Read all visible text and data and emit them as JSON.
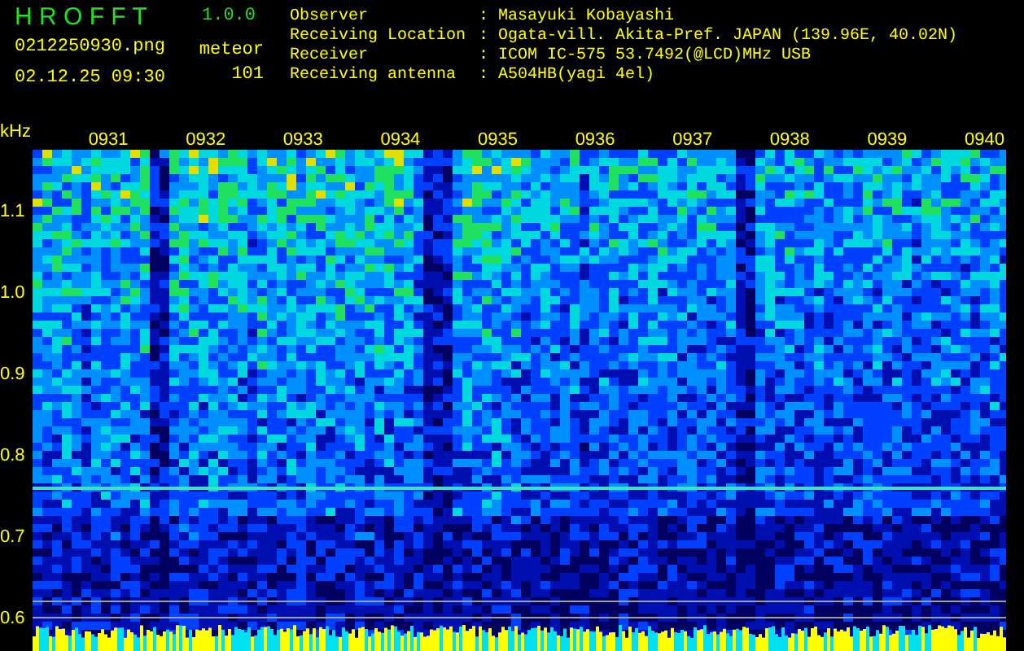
{
  "header": {
    "app_name": "H R O F F T",
    "version": "1.0.0",
    "filename": "0212250930.png",
    "datetime": "02.12.25 09:30",
    "meteor_label": "meteor",
    "meteor_count": "101"
  },
  "info": [
    {
      "label": "Observer",
      "separator": ":",
      "value": "Masayuki Kobayashi"
    },
    {
      "label": "Receiving Location",
      "separator": ":",
      "value": "Ogata-vill. Akita-Pref. JAPAN (139.96E, 40.02N)"
    },
    {
      "label": "Receiver",
      "separator": ":",
      "value": "ICOM IC-575 53.7492(@LCD)MHz USB"
    },
    {
      "label": "Receiving antenna",
      "separator": ":",
      "value": "A504HB(yagi 4el)"
    }
  ],
  "spectrogram": {
    "y_unit": "kHz",
    "y_labels": [
      "1.1",
      "1.0",
      "0.9",
      "0.8",
      "0.7",
      "0.6"
    ],
    "time_labels": [
      "0931",
      "0932",
      "0933",
      "0934",
      "0935",
      "0936",
      "0937",
      "0938",
      "0939",
      "0940"
    ]
  }
}
